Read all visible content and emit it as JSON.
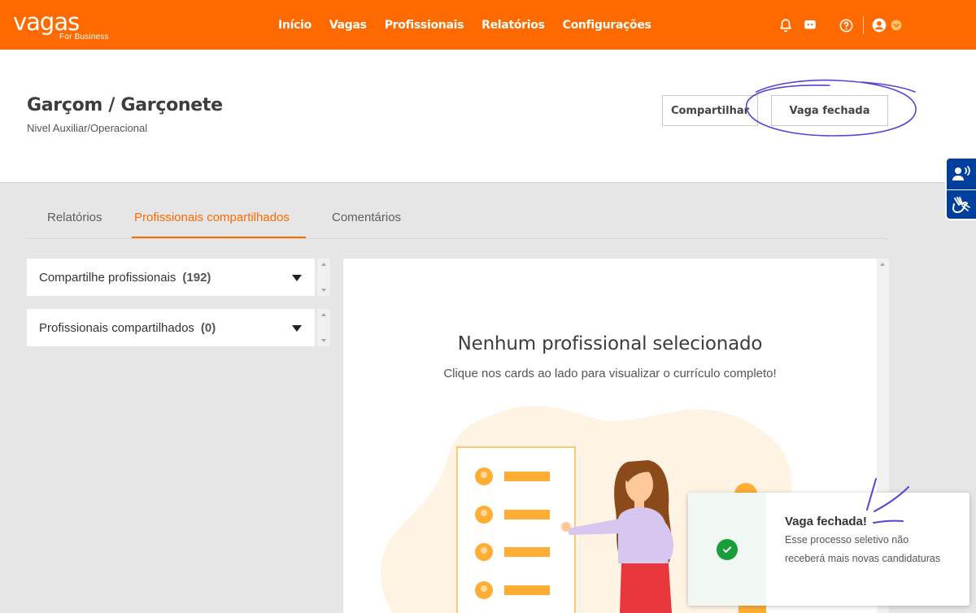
{
  "brand": {
    "name": "vagas",
    "sub": "For Business"
  },
  "nav": [
    "Início",
    "Vagas",
    "Profissionais",
    "Relatórios",
    "Configurações"
  ],
  "header": {
    "title": "Garçom / Garçonete",
    "level": "Nivel Auxiliar/Operacional",
    "share_button": "Compartilhar",
    "closed_button": "Vaga fechada"
  },
  "tabs": [
    "Relatórios",
    "Profissionais compartilhados",
    "Comentários"
  ],
  "accordions": [
    {
      "label": "Compartilhe profissionais",
      "count": "(192)"
    },
    {
      "label": "Profissionais compartilhados",
      "count": "(0)"
    }
  ],
  "empty_state": {
    "title": "Nenhum profissional selecionado",
    "subtitle": "Clique nos cards ao lado para visualizar o currículo completo!"
  },
  "toast": {
    "title": "Vaga fechada!",
    "message": "Esse processo seletivo não receberá mais novas candidaturas"
  },
  "colors": {
    "brand": "#ff6a00",
    "accessibility": "#003f9e",
    "success": "#1a9e3a",
    "annotation": "#5b3fd6"
  },
  "icons": [
    "bell-icon",
    "chat-icon",
    "help-icon",
    "user-icon",
    "chevron-down-icon",
    "audio-accessibility-icon",
    "sign-language-icon",
    "check-icon"
  ]
}
